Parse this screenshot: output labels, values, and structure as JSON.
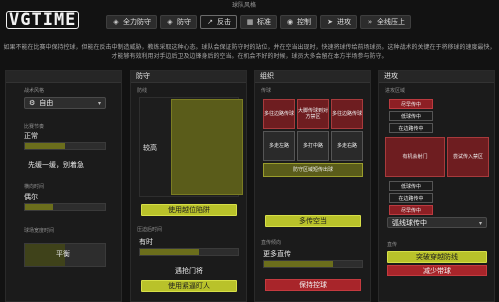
{
  "header": {
    "logo": "VGTIME",
    "top_caption": "球队风格",
    "tabs": [
      {
        "label": "全力防守",
        "icon": "shield-icon",
        "active": false
      },
      {
        "label": "防守",
        "icon": "shield-icon",
        "active": false
      },
      {
        "label": "反击",
        "icon": "arrow-icon",
        "active": true
      },
      {
        "label": "标准",
        "icon": "balance-icon",
        "active": false
      },
      {
        "label": "控制",
        "icon": "control-icon",
        "active": false
      },
      {
        "label": "进攻",
        "icon": "attack-icon",
        "active": false
      },
      {
        "label": "全线压上",
        "icon": "double-arrow-icon",
        "active": false
      }
    ]
  },
  "intro": {
    "line1": "如果不能在比赛中保持控球，但能在反击中制造威胁，教练采取这种心态。球队会保证防守时的站位，并在空当出现时，快速将球传给前场球员。这种战术的关键在于将移球的速度最快，",
    "line2": "才能够有效利用对手边后卫及边锋身后的空当。在机会不好的时候，球员大多会留在本方半场参与防守。"
  },
  "panels": {
    "general": {
      "title": "",
      "mentality_label": "战术风格",
      "mentality_value": "自由",
      "tempo_label": "比赛节奏",
      "tempo_value": "正常",
      "tempo_button": "先缓一缓，别着急",
      "tempo_fill": 0.5,
      "width_label": "横向时间",
      "width_value": "偶尔",
      "width_fill": 0.35,
      "flow_label": "球场宽度时间",
      "flow_value": "平衡",
      "flow_fill": 0.5
    },
    "defense": {
      "title": "防守",
      "block_label": "防线",
      "block_value": "较高",
      "block_button": "使用越位陷阱",
      "press_label": "压迫后时间",
      "press_value": "有时",
      "press_text": "遇抢门将",
      "press_button": "使用紧逼盯人"
    },
    "build": {
      "title": "组织",
      "passing_label": "传球",
      "cells": [
        [
          "多往边路传球",
          "大脚传球到对方禁区",
          "多往边路传球"
        ],
        [
          "多走左路",
          "多打中路",
          "多走右路"
        ]
      ],
      "bar_label": "防守区域短传出球",
      "options_button": "多传空当",
      "direct_label": "直传倾向",
      "direct_value": "更多直传",
      "direct_button": "保持控球"
    },
    "attack": {
      "title": "进攻",
      "area_label": "进攻区域",
      "pills_left": [
        "尽早传中",
        "低球传中",
        "在边路传中"
      ],
      "center_label": "有机会射门",
      "right_label": "尝试传入禁区",
      "pills_bottom": [
        "低球传中",
        "在边路传中",
        "尽早传中"
      ],
      "crossing_select": "弧线球传中",
      "through_label": "直传",
      "through_button": "突破穿越防线",
      "through_red": "减少带球"
    }
  },
  "colors": {
    "accent_yellow": "#b9c22a",
    "accent_red": "#a8252a",
    "background": "#121212"
  }
}
